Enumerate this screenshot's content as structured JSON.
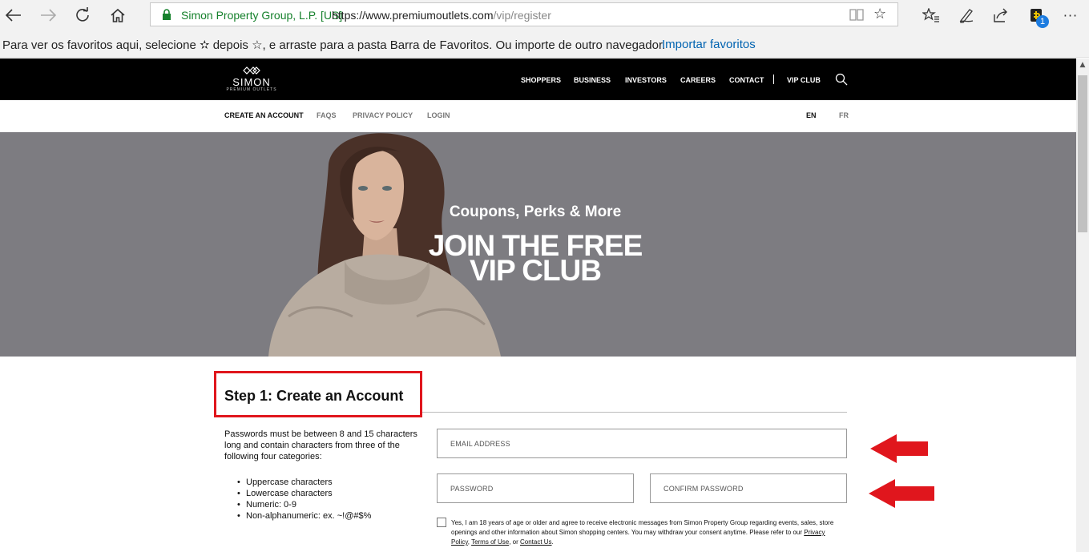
{
  "browser": {
    "nav_icons": [
      "back-arrow-icon",
      "forward-arrow-icon",
      "refresh-icon",
      "home-icon"
    ],
    "site_identity": "Simon Property Group, L.P. [US]",
    "url_host": "https://www.premiumoutlets.com",
    "url_path": "/vip/register",
    "toolbar_icons": [
      "reading-view-icon",
      "favorite-star-icon",
      "favorites-hub-icon",
      "pen-icon",
      "share-icon",
      "extension-icon",
      "more-icon"
    ],
    "extension_badge": "1",
    "more_label": "···"
  },
  "favorites_bar": {
    "message": "Para ver os favoritos aqui, selecione  ✫  depois ☆, e arraste para a pasta Barra de Favoritos. Ou importe de outro navegador.",
    "import_link": "Importar favoritos"
  },
  "site": {
    "logo": {
      "word": "SIMON",
      "sub": "PREMIUM OUTLETS"
    },
    "main_nav": [
      "SHOPPERS",
      "BUSINESS",
      "INVESTORS",
      "CAREERS",
      "CONTACT",
      "VIP CLUB"
    ],
    "sub_nav": [
      "CREATE AN ACCOUNT",
      "FAQS",
      "PRIVACY POLICY",
      "LOGIN"
    ],
    "languages": [
      "EN",
      "FR"
    ]
  },
  "hero": {
    "subtitle": "Coupons, Perks & More",
    "title_line1": "JOIN THE FREE",
    "title_line2": "VIP CLUB"
  },
  "form": {
    "step_title": "Step 1: Create an Account",
    "password_info": "Passwords must be between 8 and 15 characters long and contain characters from three of the following four categories:",
    "password_rules": [
      "Uppercase characters",
      "Lowercase characters",
      "Numeric: 0-9",
      "Non-alphanumeric: ex. ~!@#$%"
    ],
    "email_placeholder": "EMAIL ADDRESS",
    "password_placeholder": "PASSWORD",
    "confirm_placeholder": "CONFIRM PASSWORD",
    "consent_text": "Yes, I am 18 years of age or older and agree to receive electronic messages from Simon Property Group regarding events, sales, store openings and other information about Simon shopping centers. You may withdraw your consent anytime. Please refer to our ",
    "privacy_link": "Privacy Policy",
    "terms_link": "Terms of Use",
    "contact_link": "Contact Us",
    "consent_sep": ", ",
    "consent_or": ", or ",
    "consent_end": "."
  },
  "colors": {
    "annotation_red": "#e0161d",
    "hero_gray": "#7d7c81",
    "nav_black": "#000000",
    "secure_green": "#16812c"
  }
}
